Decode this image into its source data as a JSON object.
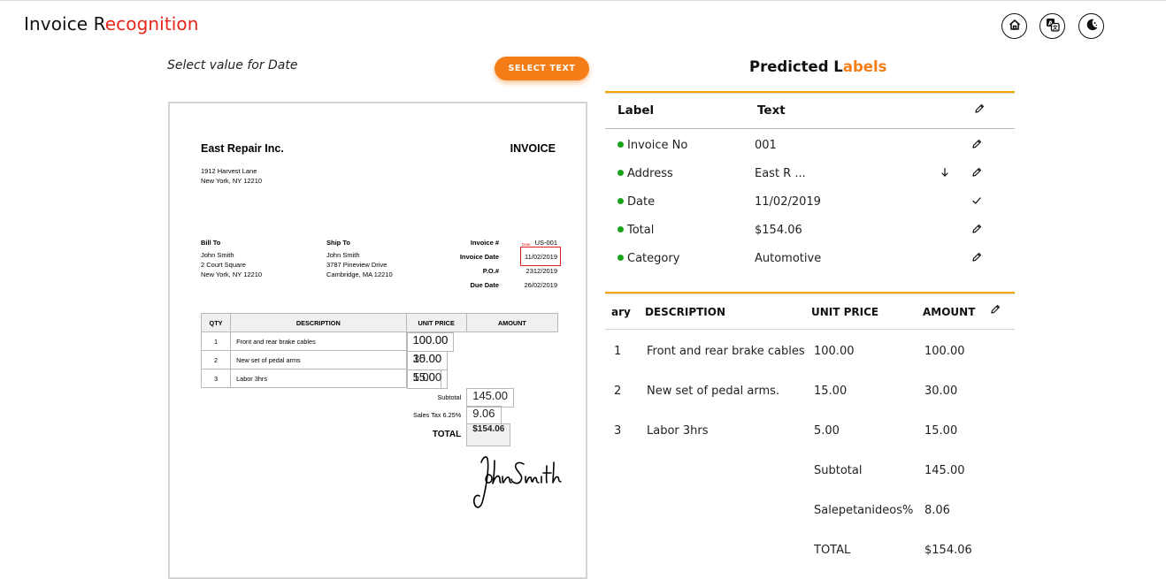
{
  "app": {
    "title_plain": "Invoice R",
    "title_accent": "ecognition"
  },
  "header_buttons": [
    "home-icon",
    "translate-icon",
    "dark-mode-icon"
  ],
  "toolbar": {
    "prompt": "Select value for Date",
    "select_button": "SELECT TEXT"
  },
  "invoice": {
    "company": "East Repair Inc.",
    "doc_title": "INVOICE",
    "company_address": [
      "1912 Harvest Lane",
      "New York, NY 12210"
    ],
    "bill_to": {
      "heading": "Bill To",
      "lines": [
        "John Smith",
        "2 Court Square",
        "New York, NY 12210"
      ]
    },
    "ship_to": {
      "heading": "Ship To",
      "lines": [
        "John Smith",
        "3787 Pineview Drive",
        "Cambridge, MA 12210"
      ]
    },
    "meta": [
      {
        "label": "Invoice #",
        "value": "US-001"
      },
      {
        "label": "Invoice Date",
        "value": "11/02/2019"
      },
      {
        "label": "P.O.#",
        "value": "2312/2019"
      },
      {
        "label": "Due Date",
        "value": "26/02/2019"
      }
    ],
    "highlight_tag": "Date",
    "table_headers": [
      "QTY",
      "DESCRIPTION",
      "UNIT PRICE",
      "AMOUNT"
    ],
    "rows": [
      {
        "qty": "1",
        "desc": "Front and rear brake cables",
        "unit": "100.00",
        "amount": "100.00"
      },
      {
        "qty": "2",
        "desc": "New set of pedal arms",
        "unit": "15.00",
        "amount": "30.00"
      },
      {
        "qty": "3",
        "desc": "Labor 3hrs",
        "unit": "5.00",
        "amount": "15.00"
      }
    ],
    "subtotal_label": "Subtotal",
    "subtotal": "145.00",
    "tax_label": "Sales Tax 6.25%",
    "tax": "9.06",
    "total_label": "TOTAL",
    "total": "$154.06",
    "signature": "John Smith"
  },
  "predicted": {
    "title_plain": "Predicted L",
    "title_accent": "abels",
    "col_label": "Label",
    "col_text": "Text",
    "labels": [
      {
        "label": "Invoice No",
        "text": "001",
        "status_color": "#1aa21a",
        "action": "pencil-icon"
      },
      {
        "label": "Address",
        "text": "East R ...",
        "status_color": "#1aa21a",
        "action": "pencil-icon",
        "extra": "arrow-down-icon"
      },
      {
        "label": "Date",
        "text": "11/02/2019",
        "status_color": "#1aa21a",
        "action": "check-icon"
      },
      {
        "label": "Total",
        "text": "$154.06",
        "status_color": "#1aa21a",
        "action": "pencil-icon"
      },
      {
        "label": "Category",
        "text": "Automotive",
        "status_color": "#1aa21a",
        "action": "pencil-icon"
      }
    ],
    "items_headers": [
      "ary",
      "DESCRIPTION",
      "UNIT PRICE",
      "AMOUNT"
    ],
    "items": [
      {
        "qty": "1",
        "desc": "Front and rear brake cables",
        "unit": "100.00",
        "amount": "100.00"
      },
      {
        "qty": "2",
        "desc": "New set of pedal arms.",
        "unit": "15.00",
        "amount": "30.00"
      },
      {
        "qty": "3",
        "desc": "Labor 3hrs",
        "unit": "5.00",
        "amount": "15.00"
      }
    ],
    "summary": [
      {
        "label": "Subtotal",
        "value": "145.00"
      },
      {
        "label": "Salepetanideos%",
        "value": "8.06"
      },
      {
        "label": "TOTAL",
        "value": "$154.06"
      }
    ]
  },
  "colors": {
    "accent_red": "#e8251b",
    "accent_orange": "#f57d17",
    "divider_gold": "#f5a400",
    "status_green": "#1aa21a",
    "highlight_red": "#e02020"
  }
}
